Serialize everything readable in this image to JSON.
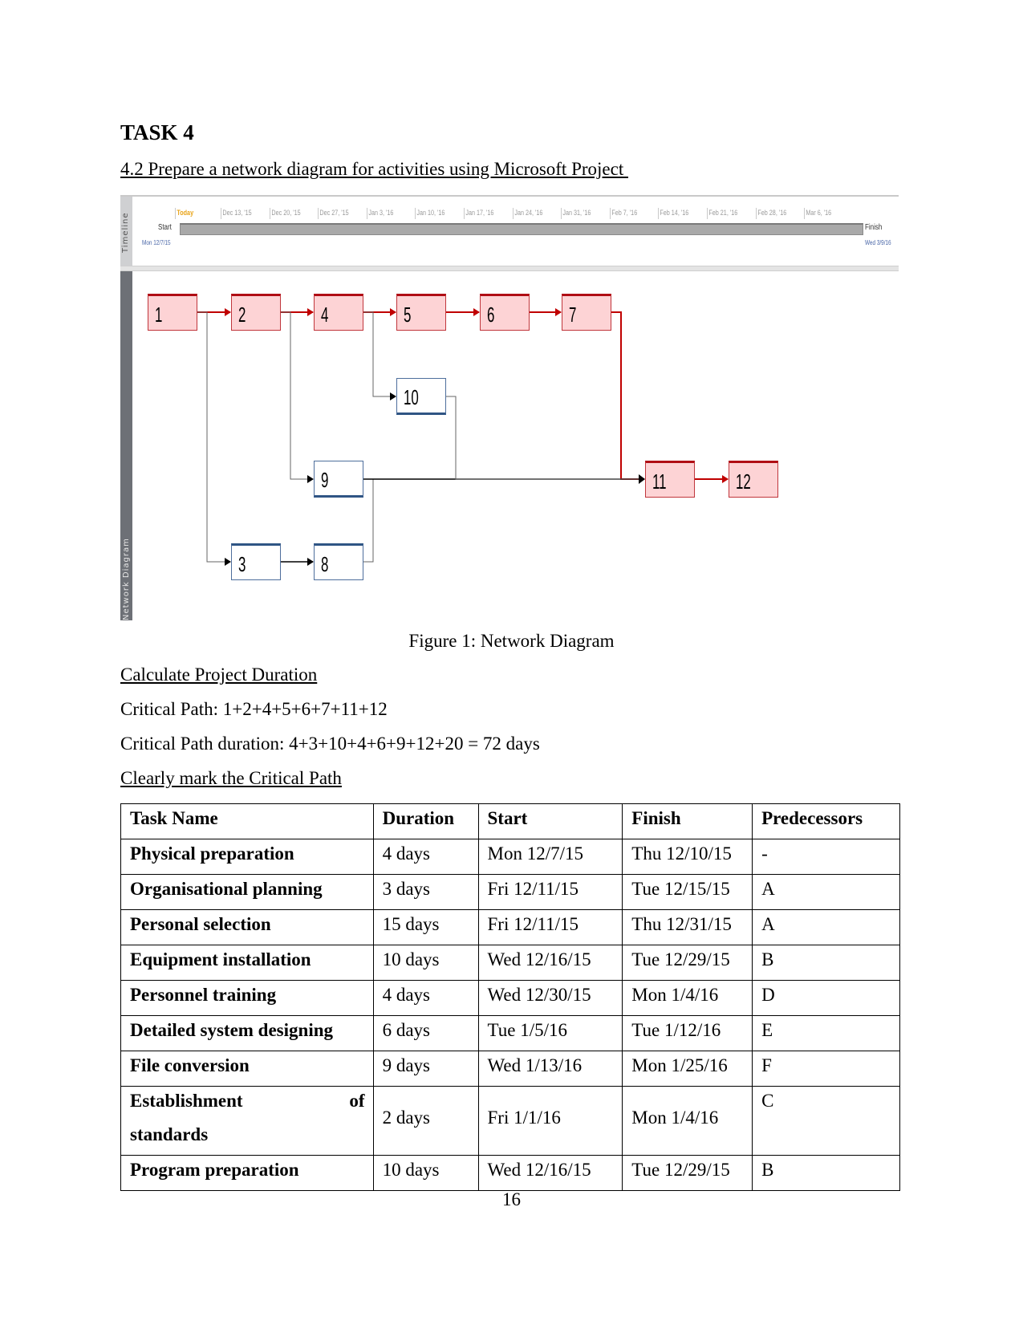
{
  "heading": "TASK 4",
  "subheading": "4.2 Prepare a network diagram for activities using Microsoft Project ",
  "figure": {
    "caption": "Figure 1: Network Diagram",
    "timeline": {
      "panel_label": "Timeline",
      "today_label": "Today",
      "ticks": [
        "Dec 13, '15",
        "Dec 20, '15",
        "Dec 27, '15",
        "Jan 3, '16",
        "Jan 10, '16",
        "Jan 17, '16",
        "Jan 24, '16",
        "Jan 31, '16",
        "Feb 7, '16",
        "Feb 14, '16",
        "Feb 21, '16",
        "Feb 28, '16",
        "Mar 6, '16"
      ],
      "start_label": "Start",
      "start_date": "Mon 12/7/15",
      "finish_label": "Finish",
      "finish_date": "Wed 3/9/16"
    },
    "network": {
      "panel_label": "Network Diagram",
      "colors": {
        "critical_fill": "#fdd3d5",
        "critical_border": "#b00d14",
        "normal_border": "#2f5584",
        "critical_link": "#c00000",
        "normal_link": "#000000"
      },
      "nodes": [
        {
          "id": "1",
          "critical": true
        },
        {
          "id": "2",
          "critical": true
        },
        {
          "id": "4",
          "critical": true
        },
        {
          "id": "5",
          "critical": true
        },
        {
          "id": "6",
          "critical": true
        },
        {
          "id": "7",
          "critical": true
        },
        {
          "id": "10",
          "critical": false
        },
        {
          "id": "9",
          "critical": false
        },
        {
          "id": "11",
          "critical": true
        },
        {
          "id": "12",
          "critical": true
        },
        {
          "id": "3",
          "critical": false
        },
        {
          "id": "8",
          "critical": false
        }
      ],
      "links": [
        {
          "from": "1",
          "to": "2",
          "critical": true
        },
        {
          "from": "2",
          "to": "4",
          "critical": true
        },
        {
          "from": "4",
          "to": "5",
          "critical": true
        },
        {
          "from": "5",
          "to": "6",
          "critical": true
        },
        {
          "from": "6",
          "to": "7",
          "critical": true
        },
        {
          "from": "7",
          "to": "11",
          "critical": true
        },
        {
          "from": "11",
          "to": "12",
          "critical": true
        },
        {
          "from": "1",
          "to": "3",
          "critical": false
        },
        {
          "from": "2",
          "to": "9",
          "critical": false
        },
        {
          "from": "4",
          "to": "10",
          "critical": false
        },
        {
          "from": "3",
          "to": "8",
          "critical": false
        },
        {
          "from": "8",
          "to": "11",
          "critical": false
        },
        {
          "from": "9",
          "to": "11",
          "critical": false
        },
        {
          "from": "10",
          "to": "11",
          "critical": false
        }
      ]
    }
  },
  "section_duration": "Calculate Project Duration",
  "critical_path": "Critical Path: 1+2+4+5+6+7+11+12",
  "critical_path_duration": "Critical Path duration: 4+3+10+4+6+9+12+20 = 72 days",
  "section_mark": "Clearly mark the Critical Path",
  "table": {
    "headers": [
      "Task Name",
      "Duration",
      "Start",
      "Finish",
      "Predecessors"
    ],
    "rows": [
      {
        "name": "Physical preparation",
        "duration": "4 days",
        "start": "Mon 12/7/15",
        "finish": "Thu 12/10/15",
        "pred": "-"
      },
      {
        "name": "Organisational planning",
        "duration": "3 days",
        "start": "Fri 12/11/15",
        "finish": "Tue 12/15/15",
        "pred": "A"
      },
      {
        "name": "Personal selection",
        "duration": "15 days",
        "start": "Fri 12/11/15",
        "finish": "Thu 12/31/15",
        "pred": "A"
      },
      {
        "name": "Equipment installation",
        "duration": "10 days",
        "start": "Wed 12/16/15",
        "finish": "Tue 12/29/15",
        "pred": "B"
      },
      {
        "name": "Personnel training",
        "duration": "4 days",
        "start": "Wed 12/30/15",
        "finish": "Mon 1/4/16",
        "pred": "D"
      },
      {
        "name": "Detailed system designing",
        "duration": "6 days",
        "start": "Tue 1/5/16",
        "finish": "Tue 1/12/16",
        "pred": "E"
      },
      {
        "name": "File conversion",
        "duration": "9 days",
        "start": "Wed 1/13/16",
        "finish": "Mon 1/25/16",
        "pred": "F"
      },
      {
        "name_line1_a": "Establishment",
        "name_line1_b": "of",
        "name_line2": "standards",
        "duration": "2 days",
        "start": "Fri 1/1/16",
        "finish": "Mon 1/4/16",
        "pred": "C"
      },
      {
        "name": "Program preparation",
        "duration": "10 days",
        "start": "Wed 12/16/15",
        "finish": "Tue 12/29/15",
        "pred": "B"
      }
    ]
  },
  "page_number": "16"
}
